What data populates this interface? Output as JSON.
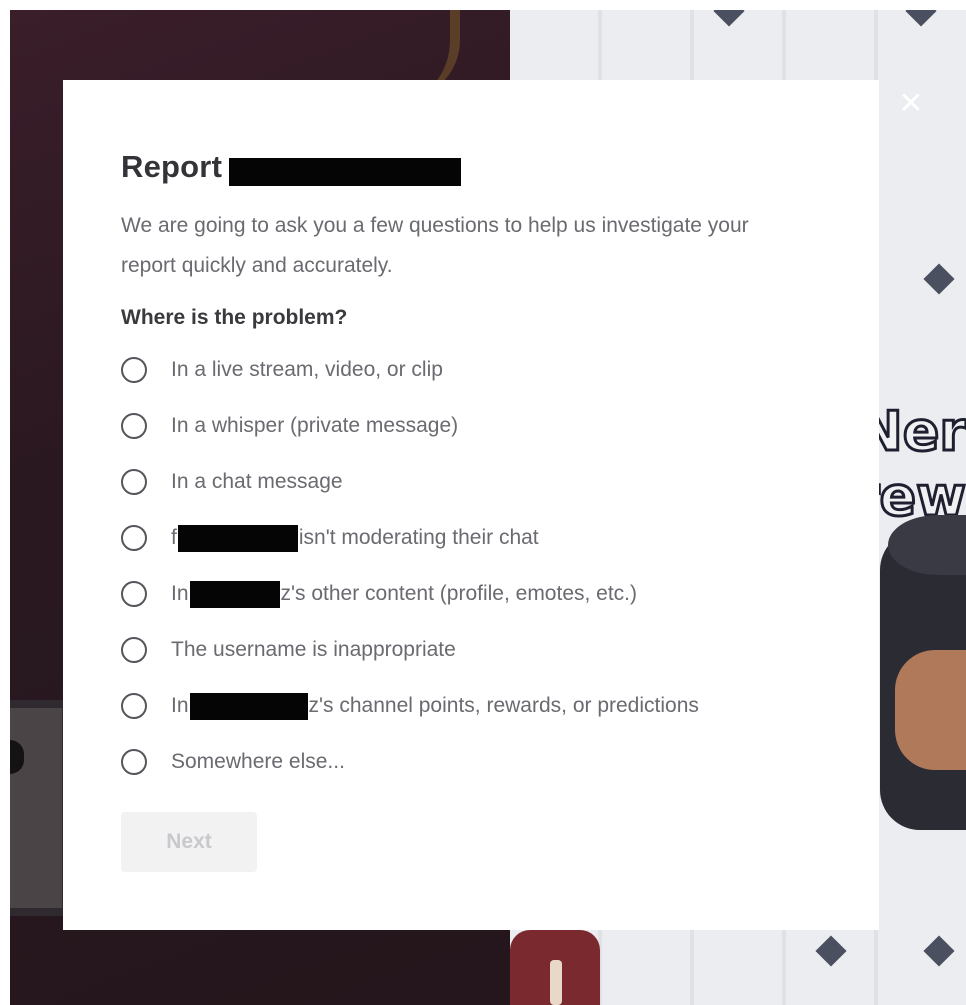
{
  "dialog": {
    "title": "Report",
    "intro": "We are going to ask you a few questions to help us investigate your report quickly and accurately.",
    "question": "Where is the problem?",
    "close_icon": "close-icon",
    "next_label": "Next",
    "next_enabled": false
  },
  "options": [
    {
      "label": "In a live stream, video, or clip",
      "selected": false
    },
    {
      "label": "In a whisper (private message)",
      "selected": false
    },
    {
      "prefix": "f",
      "suffix": "isn't moderating their chat",
      "redacted": true,
      "selected": false
    },
    {
      "prefix": "In",
      "suffix": "z's other content (profile, emotes, etc.)",
      "redacted": true,
      "selected": false
    },
    {
      "label": "In a chat message",
      "selected": false
    },
    {
      "label": "The username is inappropriate",
      "selected": false
    },
    {
      "prefix": "In",
      "suffix": "z's channel points, rewards, or predictions",
      "redacted": true,
      "selected": false
    },
    {
      "label": "Somewhere else...",
      "selected": false
    }
  ],
  "background_text": {
    "line1": "Ner",
    "line2": "rew"
  },
  "colors": {
    "modal_bg": "#ffffff",
    "overlay_dark": "#2b1c24",
    "button_disabled_bg": "#f2f2f3",
    "button_disabled_text": "#c9c9cd"
  }
}
